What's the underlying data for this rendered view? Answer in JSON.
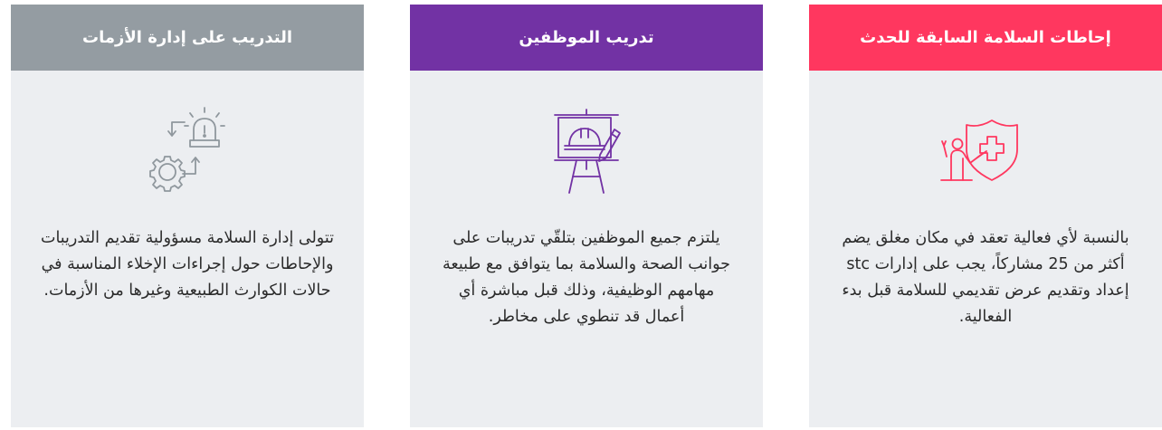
{
  "colors": {
    "safety_accent": "#ff375f",
    "training_accent": "#7232a4",
    "crisis_accent": "#949ca2",
    "card_background": "#eceef1"
  },
  "cards": [
    {
      "title": "إحاطات السلامة السابقة للحدث",
      "icon": "presenter-shield-medical-icon",
      "text": "بالنسبة لأي فعالية تعقد في مكان مغلق يضم أكثر من 25 مشاركاً، يجب على إدارات stc إعداد وتقديم عرض تقديمي للسلامة قبل بدء الفعالية."
    },
    {
      "title": "تدريب الموظفين",
      "icon": "easel-hard-hat-icon",
      "text": "يلتزم جميع الموظفين بتلقّي تدريبات على جوانب الصحة والسلامة بما يتوافق مع طبيعة مهامهم الوظيفية، وذلك قبل مباشرة أي أعمال قد تنطوي على مخاطر."
    },
    {
      "title": "التدريب على إدارة الأزمات",
      "icon": "alarm-gear-cycle-icon",
      "text": "تتولى إدارة السلامة مسؤولية تقديم التدريبات والإحاطات حول إجراءات الإخلاء المناسبة في حالات الكوارث الطبيعية وغيرها من الأزمات."
    }
  ]
}
